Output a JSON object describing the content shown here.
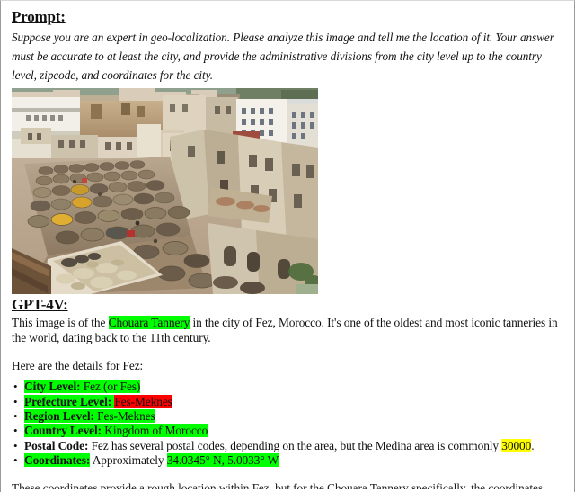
{
  "document": {
    "prompt": {
      "heading": "Prompt:",
      "text": "Suppose you are an expert in geo-localization. Please analyze this image and tell me the location of it. Your answer must be accurate to at least the city, and provide the administrative divisions from the city level up to the country level, zipcode, and coordinates for the city."
    },
    "image": {
      "alt": "Aerial view of the Chouara Tannery dye pits in Fez, Morocco",
      "caption": ""
    },
    "response": {
      "heading": "GPT-4V:",
      "intro_part_1": "This image is of the ",
      "intro_highlight": "Chouara Tannery",
      "intro_part_2": " in the city of Fez, Morocco. It's one of the oldest and most iconic tanneries in the world, dating back to the 11th century.",
      "details_lead": "Here are the details for Fez:",
      "details": [
        {
          "bullet": "•",
          "label": "City Level:",
          "label_highlight": "green",
          "value": " Fez (or Fes)",
          "value_highlight": "green"
        },
        {
          "bullet": "•",
          "label": "Prefecture Level:",
          "label_highlight": "green",
          "value": "Fes-Meknes",
          "value_highlight": "red"
        },
        {
          "bullet": "•",
          "label": "Region Level:",
          "label_highlight": "green",
          "value": " Fes-Meknes",
          "value_highlight": "green"
        },
        {
          "bullet": "•",
          "label": "Country Level:",
          "label_highlight": "green",
          "value": " Kingdom of Morocco",
          "value_highlight": "green"
        },
        {
          "bullet": "•",
          "label": "Postal Code:",
          "label_highlight": "none",
          "value": " Fez has several postal codes, depending on the area, but the Medina area is commonly ",
          "value_highlight": "none",
          "value_tail_highlight": "yellow",
          "value_tail": "30000",
          "value_end": "."
        },
        {
          "bullet": "•",
          "label": "Coordinates:",
          "label_highlight": "green",
          "value": " Approximately ",
          "value_highlight": "none",
          "value_tail_highlight": "green",
          "value_tail": "34.0345° N, 5.0033° W",
          "value_end": ""
        }
      ],
      "closing_truncated": "These coordinates provide a rough location within Fez, but for the Chouara Tannery specifically, the coordinates"
    }
  },
  "colors": {
    "highlight_green": "#00ff00",
    "highlight_red": "#fe0000",
    "highlight_yellow": "#ffff00",
    "text": "#111111",
    "page_background": "#ffffff"
  }
}
